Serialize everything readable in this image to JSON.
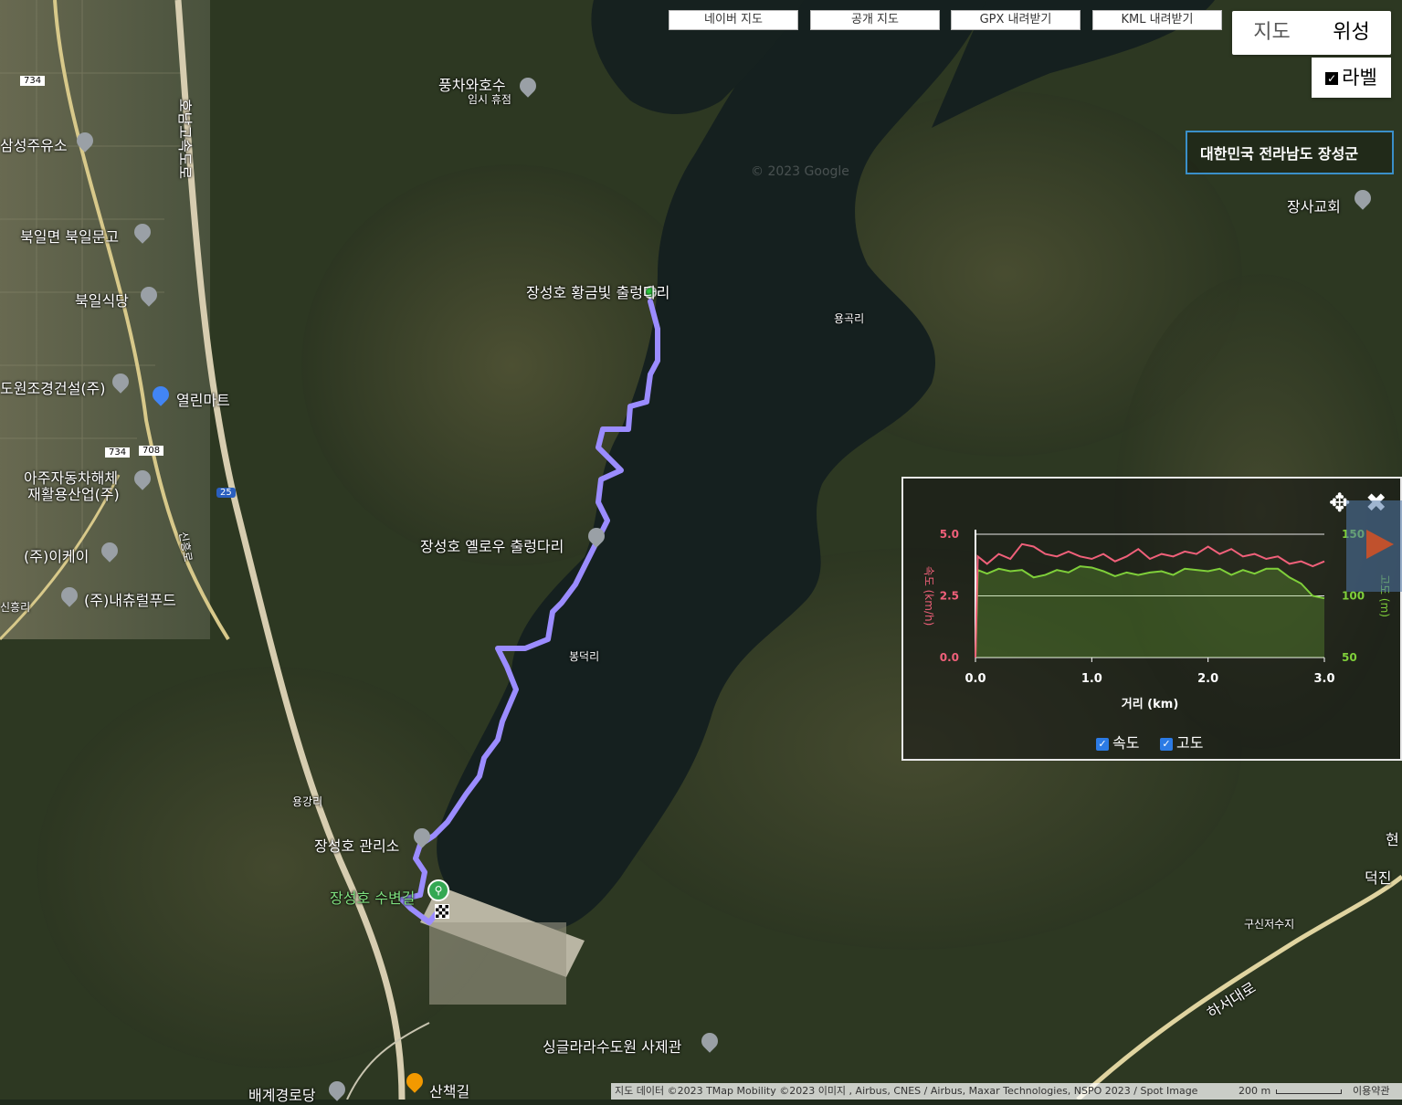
{
  "toolbar": {
    "naver_map": "네이버 지도",
    "public_map": "공개 지도",
    "gpx_download": "GPX 내려받기",
    "kml_download": "KML 내려받기"
  },
  "map_type": {
    "map": "지도",
    "satellite": "위성",
    "labels": "라벨",
    "labels_checked": true
  },
  "location": "대한민국 전라남도 장성군",
  "pois": {
    "windmill_cafe": "풍차와호수",
    "windmill_sub": "임시 휴점",
    "samsung_gas": "삼성주유소",
    "bukil_library": "북일면 북일문고",
    "bukil_restaurant": "북일식당",
    "landscape": "도원조경건설(주)",
    "yeollin_mart": "열린마트",
    "aju_car": "아주자동차해체",
    "aju_car2": "재활용산업(주)",
    "ikey": "(주)이케이",
    "natural_food": "(주)내츄럴푸드",
    "sinheungri": "신흥리",
    "golden_bridge": "장성호 황금빛 출렁다리",
    "yellow_bridge": "장성호 옐로우 출렁다리",
    "yonggokri": "용곡리",
    "bongdeokri": "봉덕리",
    "yonggangri": "용강리",
    "management": "장성호 관리소",
    "water_park": "장성호 수변길",
    "church": "장사교회",
    "gusin_reservoir": "구신저수지",
    "haseo_road": "하서대로",
    "hyeon": "현",
    "deokjin": "덕진",
    "singular_sculpture": "싱글라라수도원 사제관",
    "sanchaek": "산책길",
    "baegye": "배계경로당",
    "watermark": "© 2023 Google",
    "road_734": "734",
    "road_708": "708",
    "road_25": "25",
    "honam_highway": "호남고속도로",
    "siheung_road": "신흥로"
  },
  "chart_data": {
    "type": "line",
    "xlabel": "거리 (km)",
    "ylabel_left": "속도 (km/h)",
    "ylabel_right": "고도 (m)",
    "x_ticks": [
      "0.0",
      "1.0",
      "2.0",
      "3.0"
    ],
    "y_left_ticks": [
      "0.0",
      "2.5",
      "5.0"
    ],
    "y_right_ticks": [
      "50",
      "100",
      "150"
    ],
    "xlim": [
      0,
      3.0
    ],
    "ylim_left": [
      0,
      5.0
    ],
    "ylim_right": [
      50,
      150
    ],
    "series": [
      {
        "name": "속도",
        "color": "#f0607a",
        "x": [
          0.0,
          0.02,
          0.1,
          0.2,
          0.3,
          0.4,
          0.5,
          0.6,
          0.7,
          0.8,
          0.9,
          1.0,
          1.1,
          1.2,
          1.3,
          1.4,
          1.5,
          1.6,
          1.7,
          1.8,
          1.9,
          2.0,
          2.1,
          2.2,
          2.3,
          2.4,
          2.5,
          2.6,
          2.7,
          2.8,
          2.9,
          3.0
        ],
        "values": [
          0.0,
          4.1,
          3.8,
          4.2,
          4.0,
          4.6,
          4.5,
          4.2,
          4.1,
          4.3,
          4.1,
          4.0,
          4.2,
          3.9,
          4.1,
          4.4,
          4.0,
          4.2,
          4.1,
          4.3,
          4.2,
          4.5,
          4.2,
          4.4,
          4.1,
          4.2,
          4.0,
          4.1,
          3.8,
          3.9,
          3.7,
          3.9
        ]
      },
      {
        "name": "고도",
        "color": "#7fcf3a",
        "x": [
          0.0,
          0.02,
          0.1,
          0.2,
          0.3,
          0.4,
          0.5,
          0.6,
          0.7,
          0.8,
          0.9,
          1.0,
          1.1,
          1.2,
          1.3,
          1.4,
          1.5,
          1.6,
          1.7,
          1.8,
          1.9,
          2.0,
          2.1,
          2.2,
          2.3,
          2.4,
          2.5,
          2.6,
          2.7,
          2.8,
          2.9,
          3.0
        ],
        "values": [
          50,
          121,
          118,
          122,
          120,
          121,
          115,
          117,
          121,
          119,
          124,
          123,
          120,
          116,
          119,
          117,
          119,
          120,
          117,
          122,
          121,
          120,
          122,
          117,
          121,
          118,
          122,
          122,
          115,
          110,
          100,
          98
        ]
      }
    ]
  },
  "attribution": "지도 데이터 ©2023 TMap Mobility ©2023 이미지 , Airbus, CNES / Airbus, Maxar Technologies, NSPO 2023 / Spot Image",
  "scale": "200 m",
  "terms": "이용약관"
}
